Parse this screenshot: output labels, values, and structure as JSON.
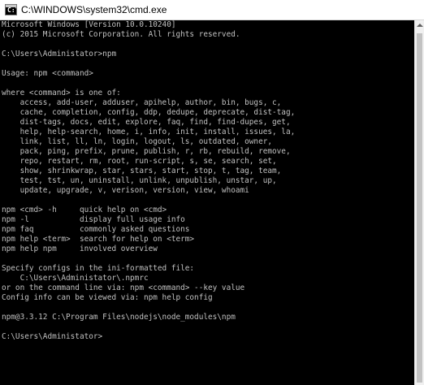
{
  "window": {
    "title": "C:\\WINDOWS\\system32\\cmd.exe"
  },
  "console": {
    "lines": [
      "Microsoft Windows [Version 10.0.10240]",
      "(c) 2015 Microsoft Corporation. All rights reserved.",
      "",
      "C:\\Users\\Administator>npm",
      "",
      "Usage: npm <command>",
      "",
      "where <command> is one of:",
      "    access, add-user, adduser, apihelp, author, bin, bugs, c,",
      "    cache, completion, config, ddp, dedupe, deprecate, dist-tag,",
      "    dist-tags, docs, edit, explore, faq, find, find-dupes, get,",
      "    help, help-search, home, i, info, init, install, issues, la,",
      "    link, list, ll, ln, login, logout, ls, outdated, owner,",
      "    pack, ping, prefix, prune, publish, r, rb, rebuild, remove,",
      "    repo, restart, rm, root, run-script, s, se, search, set,",
      "    show, shrinkwrap, star, stars, start, stop, t, tag, team,",
      "    test, tst, un, uninstall, unlink, unpublish, unstar, up,",
      "    update, upgrade, v, verison, version, view, whoami",
      "",
      "npm <cmd> -h     quick help on <cmd>",
      "npm -l           display full usage info",
      "npm faq          commonly asked questions",
      "npm help <term>  search for help on <term>",
      "npm help npm     involved overview",
      "",
      "Specify configs in the ini-formatted file:",
      "    C:\\Users\\Administator\\.npmrc",
      "or on the command line via: npm <command> --key value",
      "Config info can be viewed via: npm help config",
      "",
      "npm@3.3.12 C:\\Program Files\\nodejs\\node_modules\\npm",
      "",
      "C:\\Users\\Administator>"
    ]
  },
  "icons": {
    "app_icon": "cmd-icon",
    "app_icon_glyph": "C:\\"
  },
  "colors": {
    "console_background": "#000000",
    "console_text": "#c0c0c0",
    "titlebar_background": "#ffffff"
  }
}
